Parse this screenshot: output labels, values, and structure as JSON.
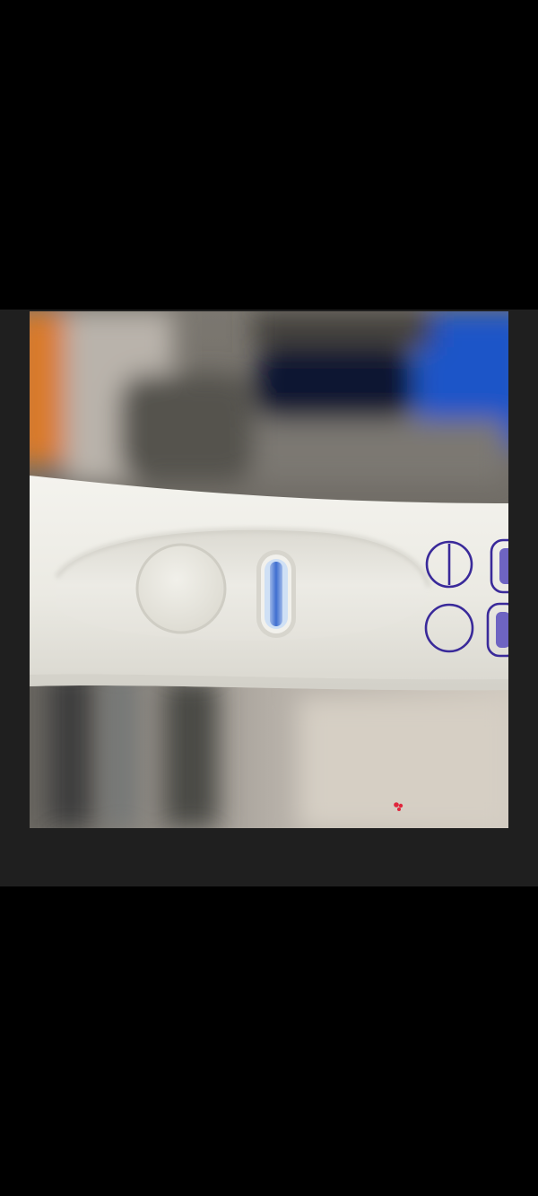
{
  "screen": {
    "background": "#000000",
    "frame_color": "#1f1f1f"
  },
  "photo": {
    "subject": "test-strip",
    "result_window": {
      "line_color": "#3f6fd0",
      "line_count": 1
    },
    "legend_symbols": [
      {
        "symbol": "circle-with-vertical-line",
        "color": "#3a2a9a"
      },
      {
        "symbol": "circle-empty",
        "color": "#3a2a9a"
      },
      {
        "symbol": "pill-with-fill",
        "color": "#3a2a9a"
      },
      {
        "symbol": "pill-with-fill",
        "color": "#3a2a9a"
      }
    ],
    "colors": {
      "strip_body": "#ecebe4",
      "blue_background_object": "#1f55c8",
      "orange_background_object": "#d97a2a"
    }
  }
}
